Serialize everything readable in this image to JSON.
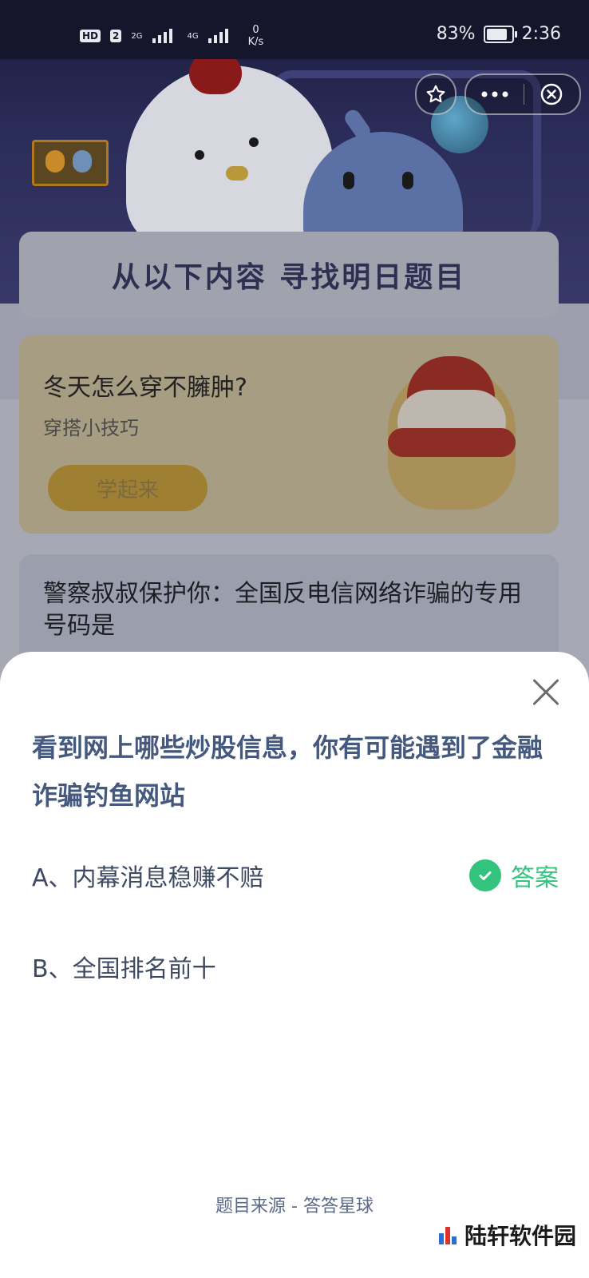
{
  "status_bar": {
    "hd": "HD",
    "sim": "2",
    "net1": "2G",
    "net2": "4G",
    "speed_value": "0",
    "speed_unit": "K/s",
    "battery": "83%",
    "battery_level": 0.83,
    "time": "2:36"
  },
  "hero": {
    "title": "从以下内容  寻找明日题目"
  },
  "card_tip": {
    "question": "冬天怎么穿不臃肿?",
    "subtitle": "穿搭小技巧",
    "button": "学起来"
  },
  "card_police": {
    "question": "警察叔叔保护你：全国反电信网络诈骗的专用号码是"
  },
  "sheet": {
    "question": "看到网上哪些炒股信息，你有可能遇到了金融诈骗钓鱼网站",
    "options": [
      {
        "label": "A、内幕消息稳赚不赔",
        "answer_label": "答案"
      },
      {
        "label": "B、全国排名前十",
        "answer_label": ""
      }
    ],
    "source": "题目来源 - 答答星球"
  },
  "watermark": "陆轩软件园",
  "colors": {
    "accent_green": "#32c37c",
    "question_blue": "#45597f"
  },
  "icons": [
    "star-icon",
    "more-icon",
    "close-circle-icon",
    "close-icon",
    "check-icon"
  ]
}
